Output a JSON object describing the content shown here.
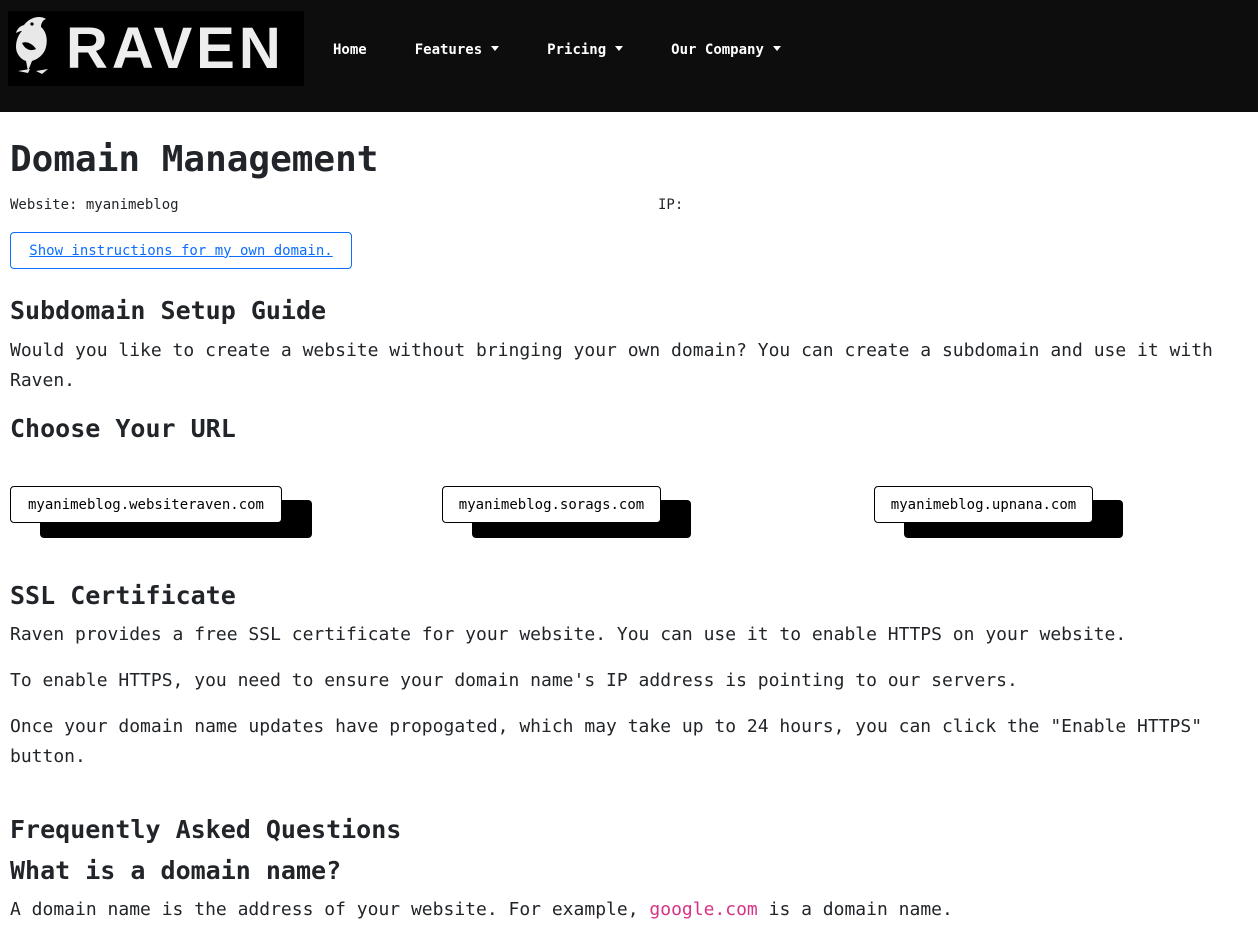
{
  "nav": {
    "brand": "RAVEN",
    "items": [
      {
        "label": "Home",
        "dropdown": false
      },
      {
        "label": "Features",
        "dropdown": true
      },
      {
        "label": "Pricing",
        "dropdown": true
      },
      {
        "label": "Our Company",
        "dropdown": true
      }
    ]
  },
  "page": {
    "title": "Domain Management",
    "website_line": "Website: myanimeblog",
    "ip_line": "IP:",
    "instructions_link": "Show instructions for my own domain."
  },
  "subdomain": {
    "heading": "Subdomain Setup Guide",
    "text": "Would you like to create a website without bringing your own domain? You can create a subdomain and use it with Raven."
  },
  "choose_url": {
    "heading": "Choose Your URL",
    "options": [
      "myanimeblog.websiteraven.com",
      "myanimeblog.sorags.com",
      "myanimeblog.upnana.com"
    ]
  },
  "ssl": {
    "heading": "SSL Certificate",
    "p1": "Raven provides a free SSL certificate for your website. You can use it to enable HTTPS on your website.",
    "p2": "To enable HTTPS, you need to ensure your domain name's IP address is pointing to our servers.",
    "p3": "Once your domain name updates have propogated, which may take up to 24 hours, you can click the \"Enable HTTPS\" button."
  },
  "faq": {
    "heading": "Frequently Asked Questions",
    "q1": "What is a domain name?",
    "a1_before": "A domain name is the address of your website. For example, ",
    "a1_code": "google.com",
    "a1_after": " is a domain name."
  },
  "colors": {
    "navbar": "#0d0d0d",
    "link_blue": "#0d6efd",
    "code_pink": "#d63384",
    "text": "#212529"
  }
}
